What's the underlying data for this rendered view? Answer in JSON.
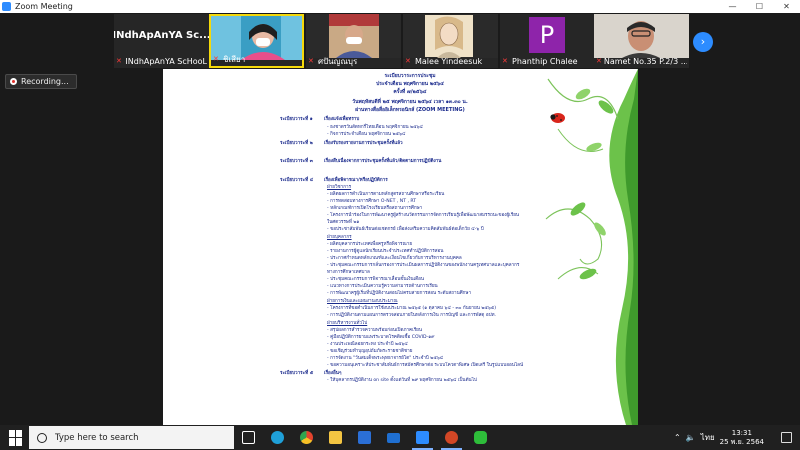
{
  "window": {
    "title": "Zoom Meeting",
    "controls": [
      "—",
      "☐",
      "✕"
    ]
  },
  "participants": [
    {
      "label": "INdhApAnYA ScHooL",
      "name_display": "INdhApAnYA Sc...",
      "muted": true,
      "kind": "name"
    },
    {
      "label": "ชิเสียา",
      "muted": true,
      "kind": "video",
      "active": true
    },
    {
      "label": "ศปันญณบุร",
      "muted": true,
      "kind": "video"
    },
    {
      "label": "Malee Yindeesuk",
      "muted": true,
      "kind": "video"
    },
    {
      "label": "Phanthip Chalee",
      "muted": true,
      "kind": "avatar",
      "initial": "P"
    },
    {
      "label": "Namet No.35 P.2/3 ...",
      "muted": true,
      "kind": "video"
    }
  ],
  "recording": {
    "label": "Recording..."
  },
  "document": {
    "header_lines": [
      "ระเบียบวาระการประชุม",
      "ประจำเดือน พฤศจิกายน ๒๕๖๔",
      "ครั้งที่ ๗/๒๕๖๔",
      "วันพฤหัสบดีที่ ๒๕ พฤศจิกายน ๒๕๖๔ เวลา ๑๓.๓๐ น.",
      "ผ่านทางสื่อสื่ออิเล็กทรอนิกส์ (ZOOM MEETING)"
    ],
    "agenda_1_head": "ระเบียบวาระที่ ๑",
    "agenda_1_title": "เรื่องแจ้งเพื่อทราบ",
    "agenda_1_items": [
      "- ธงชาตรวันสัตหกรี่ไทยเดือน พฤศจิกายน ๒๕๖๔",
      "- กิจการประจำเดือน พฤศจิกายน ๒๕๖๔"
    ],
    "agenda_2_head": "ระเบียบวาระที่ ๒",
    "agenda_2_title": "เรื่องรับรองรายงานการประชุมครั้งที่แล้ว",
    "agenda_3_head": "ระเบียบวาระที่ ๓",
    "agenda_3_title": "เรื่องสืบเนื่องจากการประชุมครั้งที่แล้ว/ติดตามการปฏิบัติงาน",
    "agenda_4_head": "ระเบียบวาระที่ ๔",
    "agenda_4_title": "เรื่องเพื่อพิจารณา/หรือปฏิบัติการ",
    "sub_academic": "ฝ่ายวิชาการ",
    "academic_items": [
      "- ผลิตผลการดำเนินการตามหลักสูตรสถานศึกษาหรือระเรียน",
      "- การทดสอบทางการศึกษา O-NET , NT , RT",
      "- หลักเกณฑ์การเปิดโรงเรียนหรือสถานการศึกษา",
      "- โครงการนำร่องในการพัฒนาครูผู้สร้างนวัตกรรมการจัดการเรียนรู้เพื่อพัฒนาสมรรถนะของผู้เรียน",
      "  ในศตวรรษที่ ๒๑",
      "- ขอประชาสัมพันธ์เรียนต่อเชตกรย์ เพื่อส่งเสริมความคิดสัมพันธ์ต่อเด็กวัย ๔-๖ ปี"
    ],
    "sub_personnel": "ฝ่ายบุคลากร",
    "personnel_items": [
      "- ผลิตบุคลากรประเทศเพื่อครูหรือพิจารณาย",
      "- รายงานการผู้ดูแลนักเรียนประจำประเทศทำปฏิบัติการสอน",
      "- ประกาศกำหนดหลักเกณฑ์และเงื่อนไขเกี่ยวกับการบริหารงานบุคคล",
      "- ประชุมคณะกรรมการกลั่นกรองการประเมินผลการปฏิบัติงานของพนักงานครูเทศบาลและบุคลากร",
      "  ทางการศึกษาเทศบาล",
      "- ประชุมคณะกรรมการพิจารณาเลื่อนขั้นเงินเดือน",
      "- แนวทางการประเมินความรู้ความสามารถด้านการเรียน",
      "- การพัฒนาครูผู้เริ่มที่ปฏิบัติงานสอนไม่ครบสายการสอน ระดับสถานศึกษา"
    ],
    "sub_budget": "ฝ่ายการเงินและแผนงานงบประมาณ",
    "budget_items": [
      "- โครงการที่ขอดำเนินการใช้งบประมาณ ๒๕๖๕ (๑ ตุลาคม ๖๔ - ๓๐ กันยายน ๒๕๖๕)",
      "- การปฏิบัติงานตามแผนการตรวจสอบภายในหลังการเงิน การบัญชี และการพัสดุ อปท."
    ],
    "sub_general": "ฝ่ายบริหารงานทั่วไป",
    "general_items": [
      "- สรุปผลการสำรวจความพร้อมก่อนเปิดภาคเรียน",
      "- คู่มือปฏิบัติการยามแพร่ระบาดโรคติดเชื้อ COVID-๑๙",
      "- งานประเพณีลอยกระทง ประจำปี ๒๕๖๔",
      "- ขอเชิญร่วมทำบุญอุปถัมภ์พระรายชาติชาย",
      "- การจัดงาน \"วันสมเด็จพระพุทธาจารย์โต\" ประจำปี ๒๕๖๔",
      "- ขอความอนุเคราะห์ประชาสัมพันธ์การสมัครศึกษาต่อ ระบบโควตาพิเศษ เปิดเสรี ในรูปแบบออนไลน์"
    ],
    "agenda_5_head": "ระเบียบวาระที่ ๕",
    "agenda_5_title": "เรื่องอื่นๆ",
    "agenda_5_items": [
      "- ให้บุคลากรปฏิบัติงาน on site ตั้งแต่วันที่ ๒๙ พฤศจิกายน ๒๕๖๔ เป็นต้นไป"
    ]
  },
  "taskbar": {
    "search_placeholder": "Type here to search",
    "apps": [
      "task-view",
      "edge",
      "chrome",
      "file-explorer",
      "store",
      "mail",
      "zoom",
      "powerpoint",
      "line"
    ],
    "lang": "ไทย",
    "time": "13:31",
    "date": "25 พ.ย. 2564"
  },
  "colors": {
    "zoom_blue": "#2d8cff",
    "active_speaker": "#f5d90a",
    "doc_text": "#1a2a8c",
    "avatar_purple": "#8e24aa"
  }
}
